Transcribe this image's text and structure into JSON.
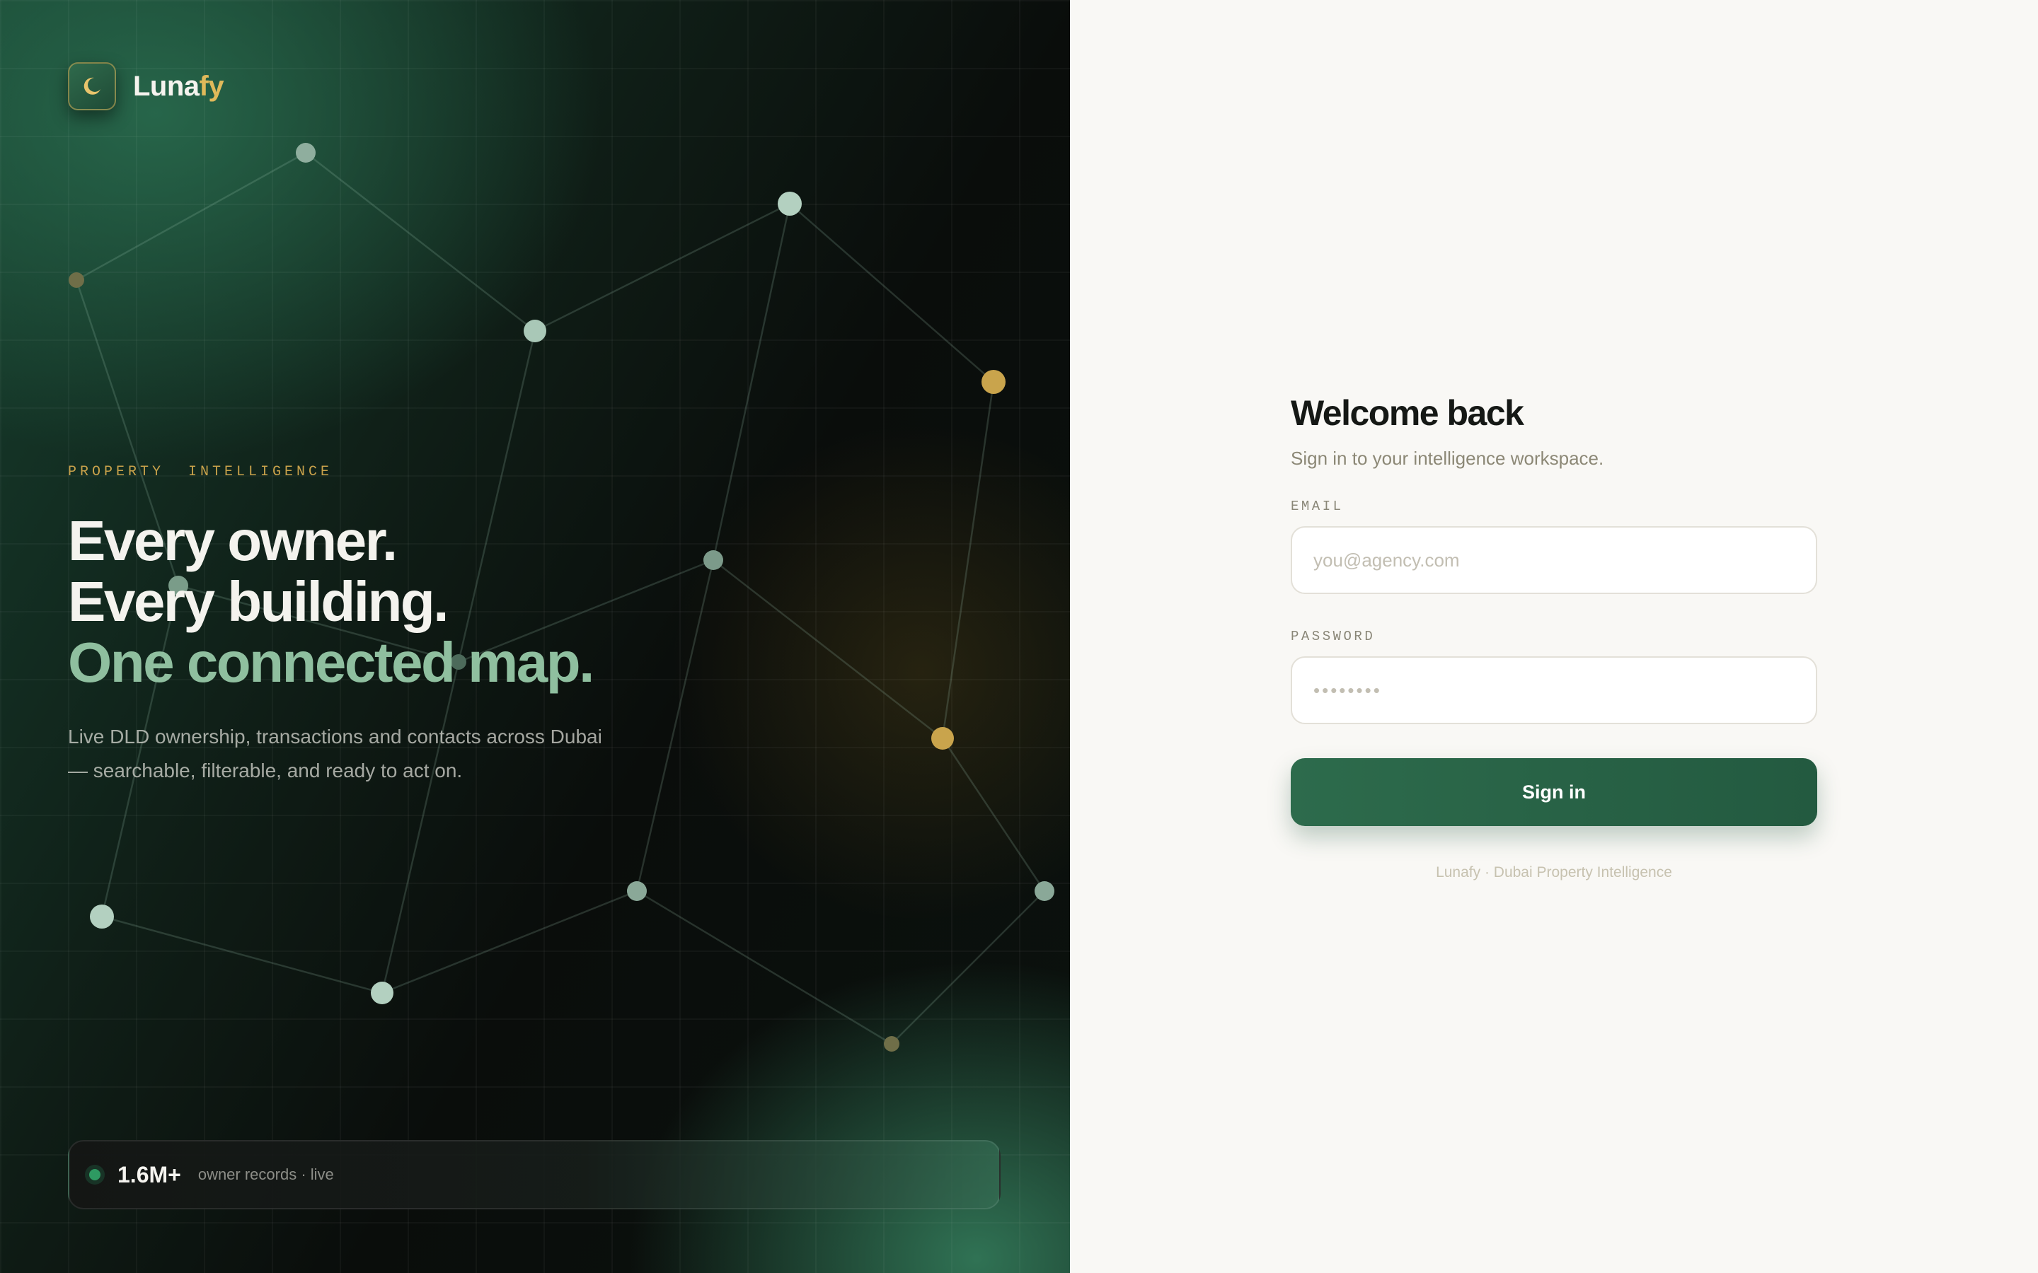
{
  "brand": {
    "name_part1": "Luna",
    "name_part2": "fy",
    "logo_icon": "crescent-moon-icon",
    "accent_color": "#e0b95a"
  },
  "hero": {
    "eyebrow": "PROPERTY  INTELLIGENCE",
    "headline_line1": "Every owner.",
    "headline_line2": "Every building.",
    "headline_line3": "One connected map.",
    "lede": "Live DLD ownership, transactions and contacts across Dubai — searchable, filterable, and ready to act on."
  },
  "stats": {
    "value": "1.6M+",
    "caption": "owner records · live",
    "status_color": "#2e9a62"
  },
  "login": {
    "title": "Welcome back",
    "subtitle": "Sign in to your intelligence workspace.",
    "email_label": "EMAIL",
    "email_placeholder": "you@agency.com",
    "password_label": "PASSWORD",
    "password_placeholder": "••••••••",
    "submit_label": "Sign in",
    "footer": "Lunafy · Dubai Property Intelligence",
    "primary_color": "#2a6648"
  }
}
